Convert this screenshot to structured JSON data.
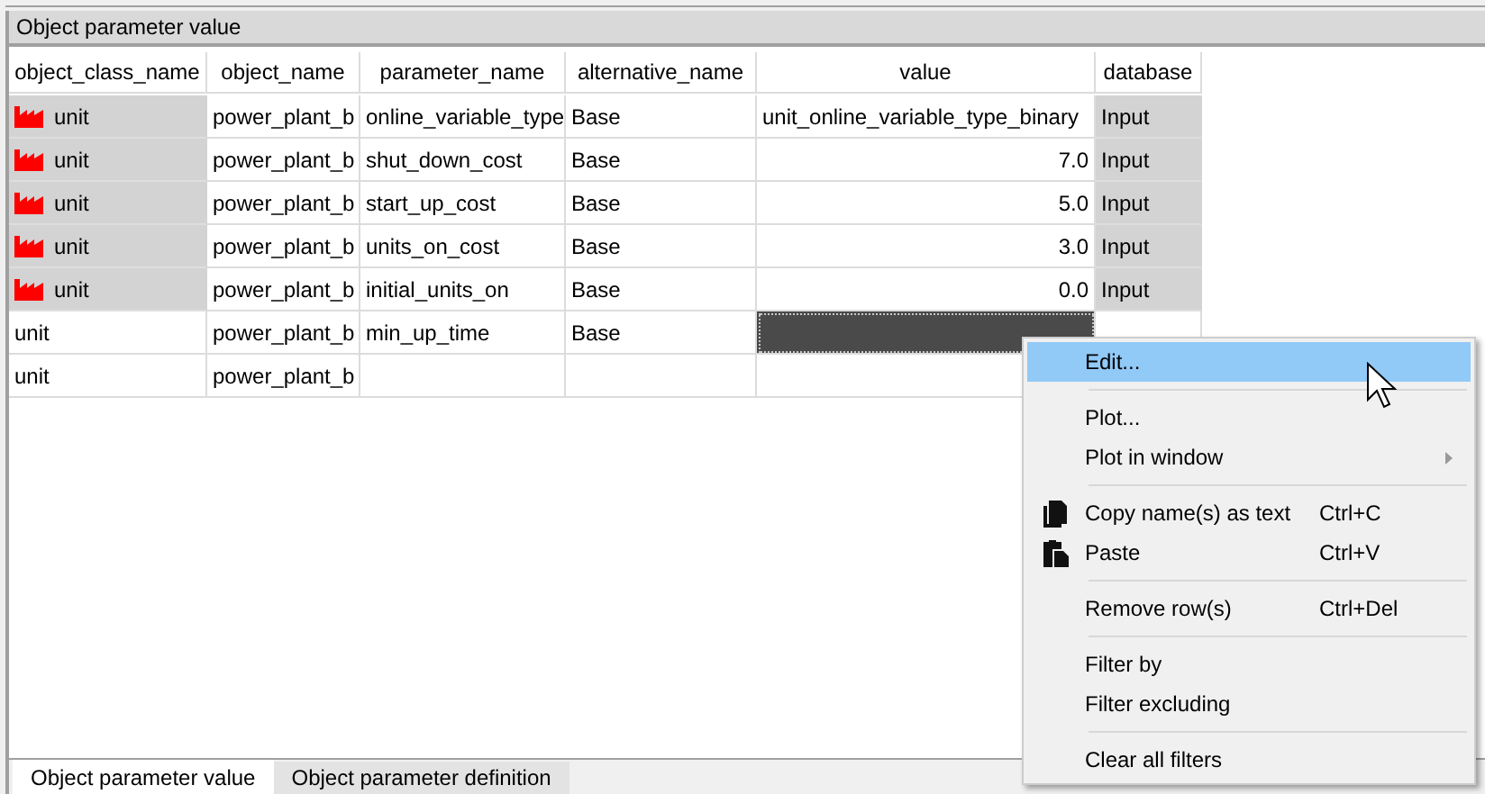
{
  "panel": {
    "title": "Object parameter value"
  },
  "table": {
    "columns": [
      "object_class_name",
      "object_name",
      "parameter_name",
      "alternative_name",
      "value",
      "database"
    ],
    "rows": [
      {
        "kind": "text_value",
        "object_class_name": "unit",
        "class_icon": true,
        "object_name": "power_plant_b",
        "parameter_name": "online_variable_type",
        "alternative_name": "Base",
        "value": "unit_online_variable_type_binary",
        "value_selected": false,
        "database": "Input",
        "readonly": true
      },
      {
        "kind": "number_value",
        "object_class_name": "unit",
        "class_icon": true,
        "object_name": "power_plant_b",
        "parameter_name": "shut_down_cost",
        "alternative_name": "Base",
        "value": "7.0",
        "value_selected": false,
        "database": "Input",
        "readonly": true
      },
      {
        "kind": "number_value",
        "object_class_name": "unit",
        "class_icon": true,
        "object_name": "power_plant_b",
        "parameter_name": "start_up_cost",
        "alternative_name": "Base",
        "value": "5.0",
        "value_selected": false,
        "database": "Input",
        "readonly": true
      },
      {
        "kind": "number_value",
        "object_class_name": "unit",
        "class_icon": true,
        "object_name": "power_plant_b",
        "parameter_name": "units_on_cost",
        "alternative_name": "Base",
        "value": "3.0",
        "value_selected": false,
        "database": "Input",
        "readonly": true
      },
      {
        "kind": "number_value",
        "object_class_name": "unit",
        "class_icon": true,
        "object_name": "power_plant_b",
        "parameter_name": "initial_units_on",
        "alternative_name": "Base",
        "value": "0.0",
        "value_selected": false,
        "database": "Input",
        "readonly": true
      },
      {
        "kind": "number_value",
        "object_class_name": "unit",
        "class_icon": false,
        "object_name": "power_plant_b",
        "parameter_name": "min_up_time",
        "alternative_name": "Base",
        "value_selected": true,
        "readonly": false
      },
      {
        "kind": "new_row",
        "object_class_name": "unit",
        "class_icon": false,
        "object_name": "power_plant_b",
        "value_selected": false,
        "readonly": false
      }
    ]
  },
  "context_menu": {
    "items": [
      {
        "kind": "item",
        "label": "Edit...",
        "selected": true
      },
      {
        "kind": "separator"
      },
      {
        "kind": "item",
        "label": "Plot...",
        "selected": false
      },
      {
        "kind": "submenu",
        "label": "Plot in window",
        "selected": false
      },
      {
        "kind": "separator"
      },
      {
        "kind": "copy",
        "label": "Copy name(s) as text",
        "shortcut": "Ctrl+C",
        "selected": false
      },
      {
        "kind": "paste",
        "label": "Paste",
        "shortcut": "Ctrl+V",
        "selected": false
      },
      {
        "kind": "separator"
      },
      {
        "kind": "item",
        "label": "Remove row(s)",
        "shortcut": "Ctrl+Del",
        "selected": false
      },
      {
        "kind": "separator"
      },
      {
        "kind": "item",
        "label": "Filter by",
        "selected": false
      },
      {
        "kind": "item",
        "label": "Filter excluding",
        "selected": false
      },
      {
        "kind": "separator"
      },
      {
        "kind": "item",
        "label": "Clear all filters",
        "selected": false
      }
    ]
  },
  "tabs": [
    {
      "label": "Object parameter value",
      "selected": true
    },
    {
      "label": "Object parameter definition",
      "selected": false
    }
  ]
}
